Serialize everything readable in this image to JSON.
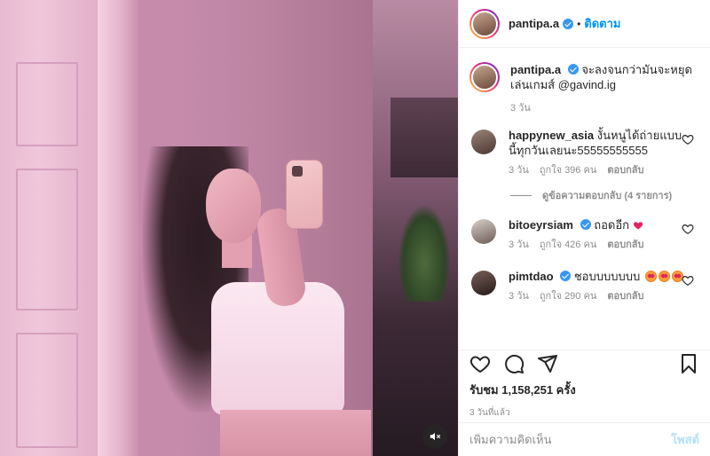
{
  "post": {
    "author": "pantipa.a",
    "follow_label": "ติดตาม",
    "dot": "•",
    "caption_user": "pantipa.a",
    "caption_text": "จะลงจนกว่ามันจะหยุดเล่นเกมส์ @gavind.ig",
    "caption_time": "3 วัน"
  },
  "comments": [
    {
      "user": "happynew_asia",
      "text": "งั้นหนูได้ถ่ายแบบนี้ทุกวันเลยนะ55555555555",
      "time": "3 วัน",
      "likes": "ถูกใจ 396 คน",
      "reply": "ตอบกลับ",
      "view_replies": "ดูข้อความตอบกลับ (4 รายการ)",
      "verified": false,
      "avatar_color": "#5a4a44"
    },
    {
      "user": "bitoeyrsiam",
      "text": "ถอดอีก",
      "time": "3 วัน",
      "likes": "ถูกใจ 426 คน",
      "reply": "ตอบกลับ",
      "verified": true,
      "avatar_color": "#8a7a70"
    },
    {
      "user": "pimtdao",
      "text": "ชอบบบบบบบ",
      "time": "3 วัน",
      "likes": "ถูกใจ 290 คน",
      "reply": "ตอบกลับ",
      "verified": true,
      "avatar_color": "#3c2e2c"
    }
  ],
  "stats": {
    "views": "รับชม 1,158,251 ครั้ง",
    "posted": "3 วันที่แล้ว"
  },
  "add_comment": {
    "placeholder": "เพิ่มความคิดเห็น",
    "post_label": "โพสต์"
  },
  "icons": {
    "like": "heart-icon",
    "comment": "comment-icon",
    "share": "share-icon",
    "save": "bookmark-icon",
    "mute": "mute-icon"
  },
  "colors": {
    "link_blue": "#0095f6",
    "verified_blue": "#3897f0",
    "muted_text": "#8e8e8e",
    "post_disabled": "#b2dffc"
  }
}
